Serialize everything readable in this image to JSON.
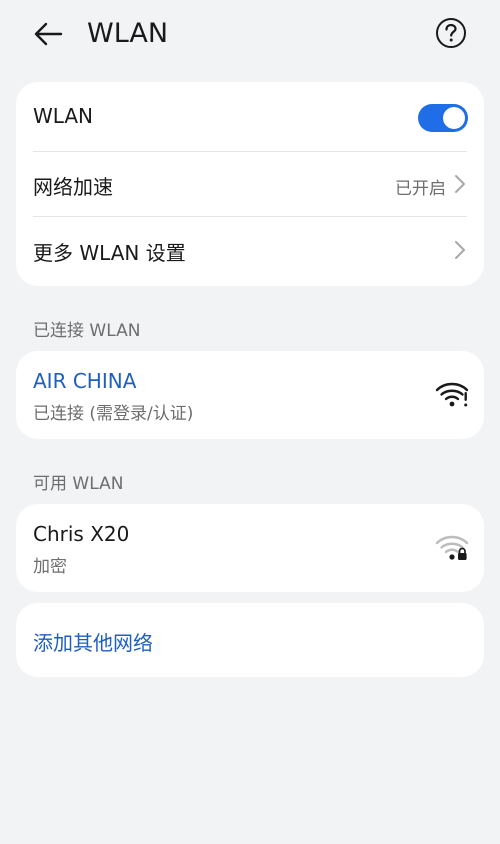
{
  "header": {
    "title": "WLAN"
  },
  "wlan_card": {
    "toggle_label": "WLAN",
    "toggle_on": true,
    "accel_label": "网络加速",
    "accel_value": "已开启",
    "more_label": "更多 WLAN 设置"
  },
  "connected_section": {
    "label": "已连接 WLAN",
    "network": {
      "name": "AIR CHINA",
      "status": "已连接 (需登录/认证)"
    }
  },
  "available_section": {
    "label": "可用 WLAN",
    "network": {
      "name": "Chris X20",
      "status": "加密"
    }
  },
  "add_network_label": "添加其他网络",
  "colors": {
    "accent": "#1f6ee8",
    "link": "#1f5fbf",
    "background": "#f1f3f5"
  },
  "icons": [
    "back-arrow-icon",
    "help-icon",
    "chevron-right-icon",
    "wifi-strong-icon",
    "wifi-locked-icon"
  ]
}
